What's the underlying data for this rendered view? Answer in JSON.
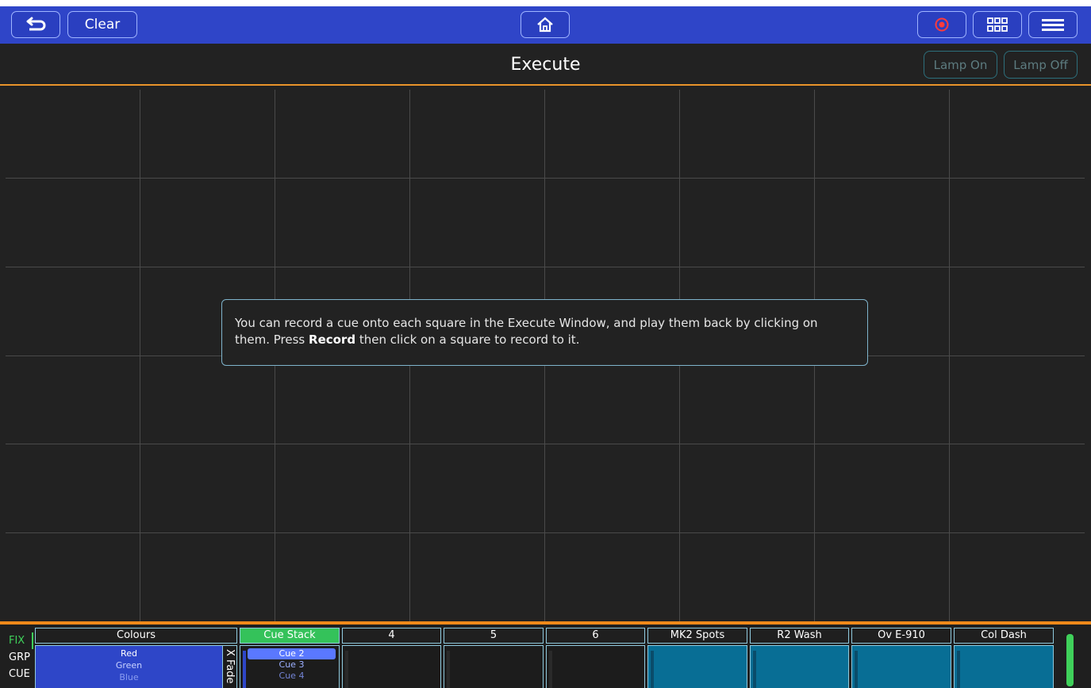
{
  "toolbar": {
    "back_icon": "back-arrow-icon",
    "clear_label": "Clear",
    "home_icon": "home-icon",
    "record_icon": "record-icon",
    "grid_icon": "grid-view-icon",
    "menu_icon": "hamburger-menu-icon"
  },
  "header": {
    "title": "Execute",
    "lamp_on_label": "Lamp On",
    "lamp_off_label": "Lamp Off"
  },
  "info": {
    "text_before": "You can record a cue onto each square in the Execute Window, and play them back by clicking on them. Press ",
    "bold": "Record",
    "text_after": " then click on a square to record to it."
  },
  "modes": [
    {
      "label": "FIX",
      "active": true
    },
    {
      "label": "GRP",
      "active": false
    },
    {
      "label": "CUE",
      "active": false
    }
  ],
  "playbacks": {
    "colours": {
      "title": "Colours",
      "items": [
        "Red",
        "Green",
        "Blue"
      ],
      "xfade_label": "X Fade"
    },
    "cue_stack": {
      "title": "Cue Stack",
      "cues": [
        "Cue 2",
        "Cue 3",
        "Cue 4"
      ],
      "selected": "Cue 2"
    },
    "others": [
      "4",
      "5",
      "6",
      "MK2 Spots",
      "R2 Wash",
      "Ov E-910",
      "Col Dash"
    ]
  },
  "colors": {
    "topbar": "#2f45c8",
    "accent_orange": "#f08a1a",
    "active_green": "#3fd05a",
    "record_red": "#ff3b3b",
    "teal": "#086e95"
  }
}
